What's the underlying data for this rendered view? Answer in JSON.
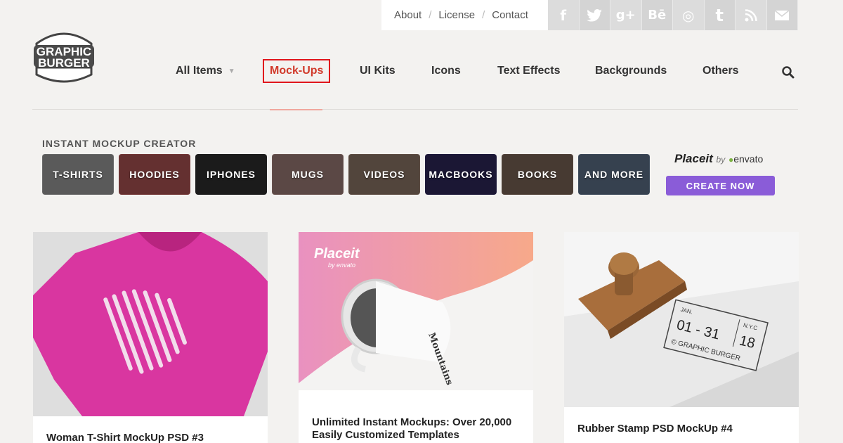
{
  "top_links": {
    "about": "About",
    "license": "License",
    "contact": "Contact",
    "separator": "/"
  },
  "social_icons": [
    "facebook-icon",
    "twitter-icon",
    "google-plus-icon",
    "behance-icon",
    "dribbble-icon",
    "tumblr-icon",
    "rss-icon",
    "email-icon"
  ],
  "social_glyphs": {
    "facebook": "f",
    "twitter": "t",
    "google_plus": "g+",
    "behance": "Bē",
    "dribbble": "◎",
    "tumblr": "t",
    "rss": "◉",
    "email": "✉"
  },
  "logo": {
    "line1": "GRAPHIC",
    "line2": "BURGER"
  },
  "nav": {
    "all_items": "All Items",
    "mockups": "Mock-Ups",
    "ui_kits": "UI Kits",
    "icons": "Icons",
    "text_effects": "Text Effects",
    "backgrounds": "Backgrounds",
    "others": "Others"
  },
  "mockup_banner": {
    "title": "INSTANT MOCKUP CREATOR",
    "tiles": [
      "T-SHIRTS",
      "HOODIES",
      "IPHONES",
      "MUGS",
      "VIDEOS",
      "MACBOOKS",
      "BOOKS",
      "AND MORE"
    ],
    "brand": "Placeit",
    "brand_by": "by",
    "brand_envato": "envato",
    "cta": "CREATE NOW"
  },
  "cards": [
    {
      "title": "Woman T-Shirt MockUp PSD #3"
    },
    {
      "title": "Unlimited Instant Mockups: Over 20,000 Easily Customized Templates",
      "badge": "Placeit",
      "badge_sub": "by envato",
      "mug_text": "Mountains"
    },
    {
      "title": "Rubber Stamp PSD MockUp #4",
      "stamp": {
        "month": "JAN.",
        "dates": "01 - 31",
        "city": "N.Y.C",
        "day": "18",
        "brand": "© GRAPHIC BURGER"
      }
    }
  ],
  "colors": {
    "accent_red": "#e0161c",
    "placeit_purple": "#8a5cd8",
    "background": "#f3f2f0"
  }
}
